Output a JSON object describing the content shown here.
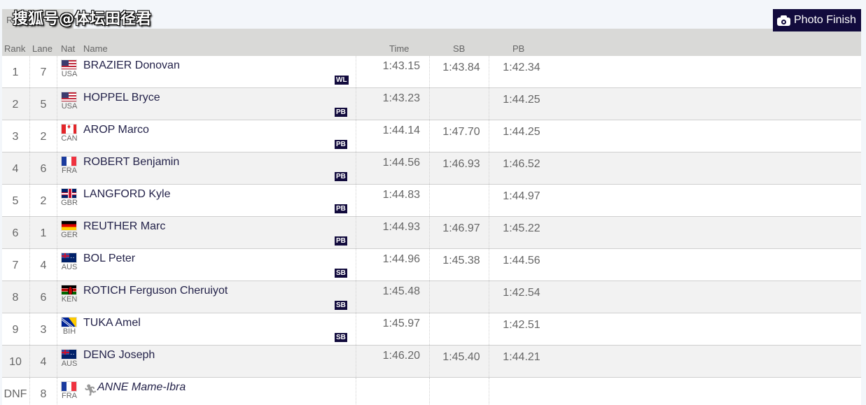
{
  "watermark": "搜狐号@体坛田径君",
  "tab_stub_label": "R",
  "photo_finish": {
    "label": "Photo Finish",
    "icon": "camera-icon"
  },
  "colors": {
    "accent": "#120b3d",
    "header_bg": "#d9d9d7",
    "alt_row_bg": "#f2f2f2",
    "name_color": "#24234a"
  },
  "table": {
    "headers": {
      "rank": "Rank",
      "lane": "Lane",
      "nat": "Nat",
      "name": "Name",
      "time": "Time",
      "sb": "SB",
      "pb": "PB"
    },
    "rows": [
      {
        "rank": "1",
        "lane": "7",
        "nat": "USA",
        "flag": "usa",
        "name": "BRAZIER Donovan",
        "badge": "WL",
        "time": "1:43.15",
        "sb": "1:43.84",
        "pb": "1:42.34"
      },
      {
        "rank": "2",
        "lane": "5",
        "nat": "USA",
        "flag": "usa",
        "name": "HOPPEL Bryce",
        "badge": "PB",
        "time": "1:43.23",
        "sb": "",
        "pb": "1:44.25"
      },
      {
        "rank": "3",
        "lane": "2",
        "nat": "CAN",
        "flag": "can",
        "name": "AROP Marco",
        "badge": "PB",
        "time": "1:44.14",
        "sb": "1:47.70",
        "pb": "1:44.25"
      },
      {
        "rank": "4",
        "lane": "6",
        "nat": "FRA",
        "flag": "fra",
        "name": "ROBERT Benjamin",
        "badge": "PB",
        "time": "1:44.56",
        "sb": "1:46.93",
        "pb": "1:46.52"
      },
      {
        "rank": "5",
        "lane": "2",
        "nat": "GBR",
        "flag": "gbr",
        "name": "LANGFORD Kyle",
        "badge": "PB",
        "time": "1:44.83",
        "sb": "",
        "pb": "1:44.97"
      },
      {
        "rank": "6",
        "lane": "1",
        "nat": "GER",
        "flag": "ger",
        "name": "REUTHER Marc",
        "badge": "PB",
        "time": "1:44.93",
        "sb": "1:46.97",
        "pb": "1:45.22"
      },
      {
        "rank": "7",
        "lane": "4",
        "nat": "AUS",
        "flag": "aus",
        "name": "BOL Peter",
        "badge": "SB",
        "time": "1:44.96",
        "sb": "1:45.38",
        "pb": "1:44.56"
      },
      {
        "rank": "8",
        "lane": "6",
        "nat": "KEN",
        "flag": "ken",
        "name": "ROTICH Ferguson Cheruiyot",
        "badge": "SB",
        "time": "1:45.48",
        "sb": "",
        "pb": "1:42.54"
      },
      {
        "rank": "9",
        "lane": "3",
        "nat": "BIH",
        "flag": "bih",
        "name": "TUKA Amel",
        "badge": "SB",
        "time": "1:45.97",
        "sb": "",
        "pb": "1:42.51"
      },
      {
        "rank": "10",
        "lane": "4",
        "nat": "AUS",
        "flag": "aus",
        "name": "DENG Joseph",
        "badge": "",
        "time": "1:46.20",
        "sb": "1:45.40",
        "pb": "1:44.21"
      },
      {
        "rank": "DNF",
        "lane": "8",
        "nat": "FRA",
        "flag": "fra",
        "name": "ANNE Mame-Ibra",
        "badge": "",
        "time": "",
        "sb": "",
        "pb": "",
        "dnf": true,
        "status_icon": "runner-icon"
      }
    ]
  }
}
